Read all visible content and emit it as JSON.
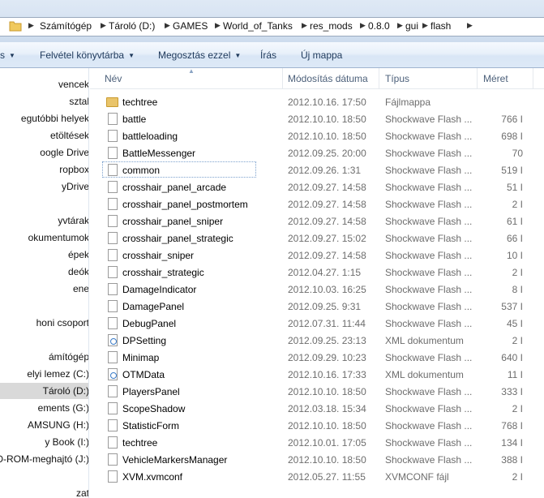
{
  "address": {
    "segments": [
      "Számítógép",
      "Tároló (D:)",
      "GAMES",
      "World_of_Tanks",
      "res_mods",
      "0.8.0",
      "gui",
      "flash"
    ]
  },
  "toolbar": {
    "organize_fragment": "s",
    "library_label": "Felvétel könyvtárba",
    "share_label": "Megosztás ezzel",
    "burn_label": "Írás",
    "new_folder_label": "Új mappa"
  },
  "nav": {
    "items": [
      "vencek",
      "sztal",
      "egutóbbi helyek",
      "etöltések",
      "oogle Drive",
      "ropbox",
      "yDrive",
      "",
      "yvtárak",
      "okumentumok",
      "épek",
      "deók",
      "ene",
      "",
      "honi csoport",
      "",
      "ámítógép",
      "elyi lemez (C:)",
      "Tároló (D:)",
      "ements (G:)",
      "AMSUNG (H:)",
      "y Book (I:)",
      "D-ROM-meghajtó (J:)",
      "",
      "zat"
    ],
    "selected_index": 18
  },
  "columns": {
    "name": "Név",
    "date": "Módosítás dátuma",
    "type": "Típus",
    "size": "Méret"
  },
  "files": [
    {
      "name": "techtree",
      "date": "2012.10.16. 17:50",
      "type": "Fájlmappa",
      "size": "",
      "icon": "folder-icon"
    },
    {
      "name": "battle",
      "date": "2012.10.10. 18:50",
      "type": "Shockwave Flash ...",
      "size": "766 I",
      "icon": "file-icon"
    },
    {
      "name": "battleloading",
      "date": "2012.10.10. 18:50",
      "type": "Shockwave Flash ...",
      "size": "698 I",
      "icon": "file-icon"
    },
    {
      "name": "BattleMessenger",
      "date": "2012.09.25. 20:00",
      "type": "Shockwave Flash ...",
      "size": "70",
      "icon": "file-icon"
    },
    {
      "name": "common",
      "date": "2012.09.26. 1:31",
      "type": "Shockwave Flash ...",
      "size": "519 I",
      "icon": "file-icon"
    },
    {
      "name": "crosshair_panel_arcade",
      "date": "2012.09.27. 14:58",
      "type": "Shockwave Flash ...",
      "size": "51 I",
      "icon": "file-icon"
    },
    {
      "name": "crosshair_panel_postmortem",
      "date": "2012.09.27. 14:58",
      "type": "Shockwave Flash ...",
      "size": "2 I",
      "icon": "file-icon"
    },
    {
      "name": "crosshair_panel_sniper",
      "date": "2012.09.27. 14:58",
      "type": "Shockwave Flash ...",
      "size": "61 I",
      "icon": "file-icon"
    },
    {
      "name": "crosshair_panel_strategic",
      "date": "2012.09.27. 15:02",
      "type": "Shockwave Flash ...",
      "size": "66 I",
      "icon": "file-icon"
    },
    {
      "name": "crosshair_sniper",
      "date": "2012.09.27. 14:58",
      "type": "Shockwave Flash ...",
      "size": "10 I",
      "icon": "file-icon"
    },
    {
      "name": "crosshair_strategic",
      "date": "2012.04.27. 1:15",
      "type": "Shockwave Flash ...",
      "size": "2 I",
      "icon": "file-icon"
    },
    {
      "name": "DamageIndicator",
      "date": "2012.10.03. 16:25",
      "type": "Shockwave Flash ...",
      "size": "8 I",
      "icon": "file-icon"
    },
    {
      "name": "DamagePanel",
      "date": "2012.09.25. 9:31",
      "type": "Shockwave Flash ...",
      "size": "537 I",
      "icon": "file-icon"
    },
    {
      "name": "DebugPanel",
      "date": "2012.07.31. 11:44",
      "type": "Shockwave Flash ...",
      "size": "45 I",
      "icon": "file-icon"
    },
    {
      "name": "DPSetting",
      "date": "2012.09.25. 23:13",
      "type": "XML dokumentum",
      "size": "2 I",
      "icon": "xml-icon"
    },
    {
      "name": "Minimap",
      "date": "2012.09.29. 10:23",
      "type": "Shockwave Flash ...",
      "size": "640 I",
      "icon": "file-icon"
    },
    {
      "name": "OTMData",
      "date": "2012.10.16. 17:33",
      "type": "XML dokumentum",
      "size": "11 I",
      "icon": "xml-icon"
    },
    {
      "name": "PlayersPanel",
      "date": "2012.10.10. 18:50",
      "type": "Shockwave Flash ...",
      "size": "333 I",
      "icon": "file-icon"
    },
    {
      "name": "ScopeShadow",
      "date": "2012.03.18. 15:34",
      "type": "Shockwave Flash ...",
      "size": "2 I",
      "icon": "file-icon"
    },
    {
      "name": "StatisticForm",
      "date": "2012.10.10. 18:50",
      "type": "Shockwave Flash ...",
      "size": "768 I",
      "icon": "file-icon"
    },
    {
      "name": "techtree",
      "date": "2012.10.01. 17:05",
      "type": "Shockwave Flash ...",
      "size": "134 I",
      "icon": "file-icon"
    },
    {
      "name": "VehicleMarkersManager",
      "date": "2012.10.10. 18:50",
      "type": "Shockwave Flash ...",
      "size": "388 I",
      "icon": "file-icon"
    },
    {
      "name": "XVM.xvmconf",
      "date": "2012.05.27. 11:55",
      "type": "XVMCONF fájl",
      "size": "2 I",
      "icon": "file-icon"
    }
  ],
  "focused_row": 4
}
